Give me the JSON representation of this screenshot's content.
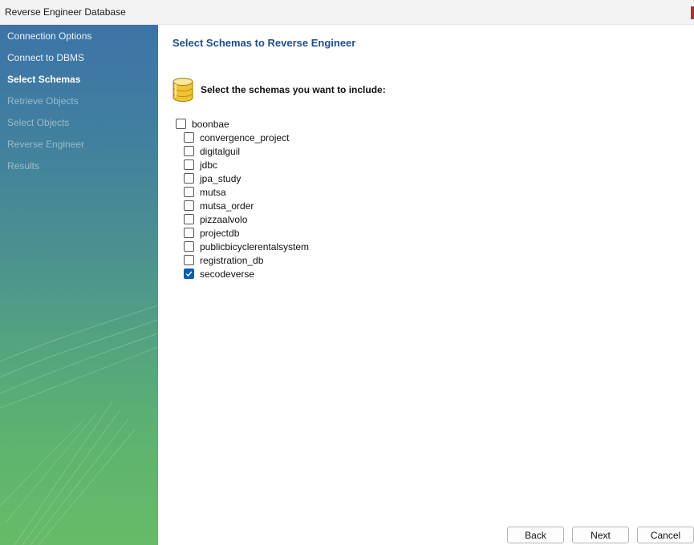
{
  "window": {
    "title": "Reverse Engineer Database"
  },
  "sidebar": {
    "steps": [
      {
        "label": "Connection Options",
        "state": "done"
      },
      {
        "label": "Connect to DBMS",
        "state": "done"
      },
      {
        "label": "Select Schemas",
        "state": "current"
      },
      {
        "label": "Retrieve Objects",
        "state": "pending"
      },
      {
        "label": "Select Objects",
        "state": "pending"
      },
      {
        "label": "Reverse Engineer",
        "state": "pending"
      },
      {
        "label": "Results",
        "state": "pending"
      }
    ]
  },
  "main": {
    "title": "Select Schemas to Reverse Engineer",
    "instruction": "Select the schemas you want to include:",
    "icon": "database-icon",
    "schemas": [
      {
        "name": "boonbae",
        "checked": false
      },
      {
        "name": "convergence_project",
        "checked": false
      },
      {
        "name": "digitalguil",
        "checked": false
      },
      {
        "name": "jdbc",
        "checked": false
      },
      {
        "name": "jpa_study",
        "checked": false
      },
      {
        "name": "mutsa",
        "checked": false
      },
      {
        "name": "mutsa_order",
        "checked": false
      },
      {
        "name": "pizzaalvolo",
        "checked": false
      },
      {
        "name": "projectdb",
        "checked": false
      },
      {
        "name": "publicbicyclerentalsystem",
        "checked": false
      },
      {
        "name": "registration_db",
        "checked": false
      },
      {
        "name": "secodeverse",
        "checked": true
      }
    ]
  },
  "footer": {
    "back_label": "Back",
    "next_label": "Next",
    "cancel_label": "Cancel"
  },
  "colors": {
    "accent": "#0a5fb4",
    "title": "#1d4f91",
    "close": "#c42b1c"
  }
}
